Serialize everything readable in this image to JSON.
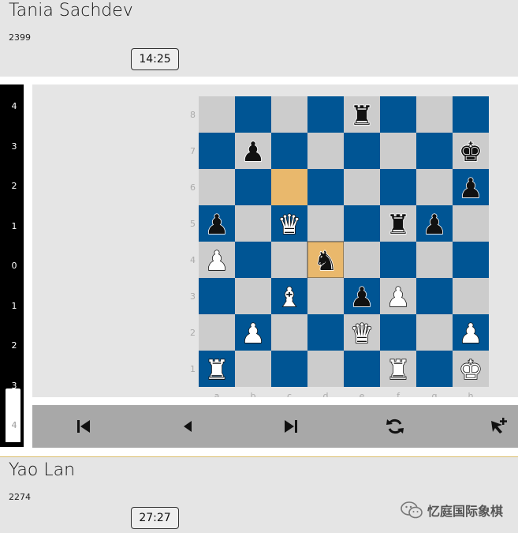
{
  "top_player": {
    "name": "Tania Sachdev",
    "rating": "2399",
    "clock": "14:25"
  },
  "bottom_player": {
    "name": "Yao Lan",
    "rating": "2274",
    "clock": "27:27"
  },
  "eval_bar": {
    "tick_labels": [
      "4",
      "3",
      "2",
      "1",
      "0",
      "1",
      "2",
      "3",
      "4"
    ],
    "white_fraction": 0.15
  },
  "board": {
    "files": [
      "a",
      "b",
      "c",
      "d",
      "e",
      "f",
      "g",
      "h"
    ],
    "ranks": [
      "8",
      "7",
      "6",
      "5",
      "4",
      "3",
      "2",
      "1"
    ],
    "light_color": "#cccccc",
    "dark_color": "#005594",
    "highlight_color": "#e9b86c",
    "highlighted_squares": [
      "c6",
      "d4"
    ],
    "pieces": [
      {
        "square": "e8",
        "piece": "bR"
      },
      {
        "square": "b7",
        "piece": "bP"
      },
      {
        "square": "h7",
        "piece": "bK"
      },
      {
        "square": "h6",
        "piece": "bP"
      },
      {
        "square": "a5",
        "piece": "bP"
      },
      {
        "square": "c5",
        "piece": "wQ"
      },
      {
        "square": "f5",
        "piece": "bR"
      },
      {
        "square": "g5",
        "piece": "bP"
      },
      {
        "square": "a4",
        "piece": "wP"
      },
      {
        "square": "d4",
        "piece": "bN"
      },
      {
        "square": "c3",
        "piece": "wB"
      },
      {
        "square": "e3",
        "piece": "bP"
      },
      {
        "square": "f3",
        "piece": "wP"
      },
      {
        "square": "b2",
        "piece": "wP"
      },
      {
        "square": "e2",
        "piece": "wQ"
      },
      {
        "square": "h2",
        "piece": "wP"
      },
      {
        "square": "a1",
        "piece": "wR"
      },
      {
        "square": "f1",
        "piece": "wR"
      },
      {
        "square": "h1",
        "piece": "wK"
      }
    ]
  },
  "controls": [
    {
      "name": "first-move-button",
      "icon": "skip-back-icon"
    },
    {
      "name": "previous-move-button",
      "icon": "play-back-icon"
    },
    {
      "name": "last-move-button",
      "icon": "skip-forward-icon"
    },
    {
      "name": "flip-board-button",
      "icon": "refresh-icon"
    },
    {
      "name": "analysis-cursor-button",
      "icon": "cursor-plus-icon"
    }
  ],
  "watermark": {
    "text": "忆庭国际象棋",
    "icon": "wechat-icon"
  }
}
